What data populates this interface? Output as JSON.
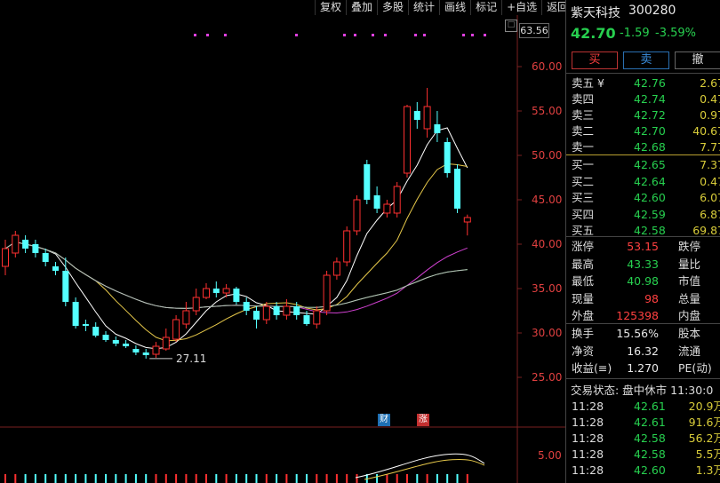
{
  "toolbar": {
    "items": [
      "复权",
      "叠加",
      "多股",
      "统计",
      "画线",
      "标记",
      "+自选",
      "返回"
    ]
  },
  "stock": {
    "name": "紫天科技",
    "code": "300280",
    "price": "42.70",
    "change": "-1.59",
    "pct": "-3.59%"
  },
  "trade_buttons": {
    "buy": "买",
    "sell": "卖",
    "cancel": "撤"
  },
  "sell_orders": [
    {
      "label": "卖五 ¥",
      "price": "42.76",
      "vol": "2.67"
    },
    {
      "label": "卖四",
      "price": "42.74",
      "vol": "0.47"
    },
    {
      "label": "卖三",
      "price": "42.72",
      "vol": "0.97"
    },
    {
      "label": "卖二",
      "price": "42.70",
      "vol": "40.67"
    },
    {
      "label": "卖一",
      "price": "42.68",
      "vol": "7.77"
    }
  ],
  "buy_orders": [
    {
      "label": "买一",
      "price": "42.65",
      "vol": "7.37"
    },
    {
      "label": "买二",
      "price": "42.64",
      "vol": "0.47"
    },
    {
      "label": "买三",
      "price": "42.60",
      "vol": "6.07"
    },
    {
      "label": "买四",
      "price": "42.59",
      "vol": "6.87"
    },
    {
      "label": "买五",
      "price": "42.58",
      "vol": "69.87"
    }
  ],
  "stats1": [
    {
      "l1": "涨停",
      "v1": "53.15",
      "c1": "red",
      "l2": "跌停"
    },
    {
      "l1": "最高",
      "v1": "43.33",
      "c1": "grn",
      "l2": "量比"
    },
    {
      "l1": "最低",
      "v1": "40.98",
      "c1": "grn",
      "l2": "市值"
    },
    {
      "l1": "现量",
      "v1": "98",
      "c1": "red",
      "l2": "总量"
    },
    {
      "l1": "外盘",
      "v1": "125398",
      "c1": "red",
      "l2": "内盘"
    }
  ],
  "stats2": [
    {
      "l1": "换手",
      "v1": "15.56%",
      "l2": "股本"
    },
    {
      "l1": "净资",
      "v1": "16.32",
      "l2": "流通"
    },
    {
      "l1": "收益(≡)",
      "v1": "1.270",
      "l2": "PE(动)"
    }
  ],
  "trade_status": "交易状态: 盘中休市 11:30:0",
  "ticks": [
    {
      "time": "11:28",
      "price": "42.61",
      "vol": "20.9万"
    },
    {
      "time": "11:28",
      "price": "42.61",
      "vol": "91.6万"
    },
    {
      "time": "11:28",
      "price": "42.58",
      "vol": "56.2万"
    },
    {
      "time": "11:28",
      "price": "42.58",
      "vol": "5.5万"
    },
    {
      "time": "11:28",
      "price": "42.60",
      "vol": "1.3万"
    }
  ],
  "chart_data": {
    "type": "candlestick",
    "y_ticks": [
      "60.00",
      "55.00",
      "50.00",
      "45.00",
      "40.00",
      "35.00",
      "30.00",
      "25.00"
    ],
    "volume_tick": "5.00",
    "max_label": "63.56",
    "min_label": "27.11",
    "event_markers": [
      "财",
      "涨"
    ],
    "candles": [
      {
        "o": 37.5,
        "c": 39.5,
        "h": 40.5,
        "l": 36.5
      },
      {
        "o": 39.0,
        "c": 41.0,
        "h": 41.5,
        "l": 38.5
      },
      {
        "o": 40.5,
        "c": 39.5,
        "h": 41.0,
        "l": 39.0
      },
      {
        "o": 40.0,
        "c": 39.0,
        "h": 40.5,
        "l": 38.5
      },
      {
        "o": 39.0,
        "c": 38.0,
        "h": 39.5,
        "l": 37.5
      },
      {
        "o": 37.5,
        "c": 37.0,
        "h": 38.0,
        "l": 36.5
      },
      {
        "o": 37.0,
        "c": 33.5,
        "h": 38.5,
        "l": 33.0
      },
      {
        "o": 33.5,
        "c": 30.8,
        "h": 34.0,
        "l": 30.5
      },
      {
        "o": 31.0,
        "c": 30.8,
        "h": 31.5,
        "l": 30.2
      },
      {
        "o": 30.7,
        "c": 29.7,
        "h": 31.2,
        "l": 29.5
      },
      {
        "o": 29.8,
        "c": 29.2,
        "h": 30.2,
        "l": 29.0
      },
      {
        "o": 29.2,
        "c": 28.8,
        "h": 29.6,
        "l": 28.5
      },
      {
        "o": 28.8,
        "c": 28.5,
        "h": 29.2,
        "l": 28.3
      },
      {
        "o": 28.2,
        "c": 27.8,
        "h": 28.6,
        "l": 27.5
      },
      {
        "o": 27.8,
        "c": 27.5,
        "h": 28.2,
        "l": 27.11
      },
      {
        "o": 27.6,
        "c": 28.5,
        "h": 29.0,
        "l": 27.2
      },
      {
        "o": 28.2,
        "c": 29.5,
        "h": 30.5,
        "l": 28.0
      },
      {
        "o": 29.3,
        "c": 31.5,
        "h": 32.0,
        "l": 29.0
      },
      {
        "o": 31.0,
        "c": 32.5,
        "h": 33.5,
        "l": 30.5
      },
      {
        "o": 32.5,
        "c": 34.0,
        "h": 35.0,
        "l": 32.0
      },
      {
        "o": 34.0,
        "c": 35.0,
        "h": 35.6,
        "l": 33.8
      },
      {
        "o": 35.0,
        "c": 34.5,
        "h": 35.8,
        "l": 34.0
      },
      {
        "o": 34.5,
        "c": 35.0,
        "h": 35.5,
        "l": 34.0
      },
      {
        "o": 35.0,
        "c": 33.5,
        "h": 35.2,
        "l": 33.2
      },
      {
        "o": 33.5,
        "c": 32.5,
        "h": 34.0,
        "l": 32.0
      },
      {
        "o": 32.5,
        "c": 31.5,
        "h": 33.0,
        "l": 30.5
      },
      {
        "o": 31.5,
        "c": 33.0,
        "h": 33.5,
        "l": 31.0
      },
      {
        "o": 33.0,
        "c": 32.0,
        "h": 33.5,
        "l": 31.5
      },
      {
        "o": 32.0,
        "c": 33.0,
        "h": 33.8,
        "l": 31.5
      },
      {
        "o": 33.0,
        "c": 32.0,
        "h": 33.5,
        "l": 31.5
      },
      {
        "o": 32.0,
        "c": 31.0,
        "h": 32.5,
        "l": 30.8
      },
      {
        "o": 31.0,
        "c": 32.5,
        "h": 33.0,
        "l": 30.5
      },
      {
        "o": 32.5,
        "c": 36.5,
        "h": 37.0,
        "l": 32.0
      },
      {
        "o": 36.5,
        "c": 38.0,
        "h": 38.5,
        "l": 36.0
      },
      {
        "o": 38.0,
        "c": 41.5,
        "h": 42.0,
        "l": 37.5
      },
      {
        "o": 41.5,
        "c": 45.0,
        "h": 45.5,
        "l": 41.0
      },
      {
        "o": 49.0,
        "c": 45.0,
        "h": 49.5,
        "l": 44.5
      },
      {
        "o": 45.5,
        "c": 44.0,
        "h": 46.5,
        "l": 43.5
      },
      {
        "o": 43.5,
        "c": 44.5,
        "h": 45.0,
        "l": 43.0
      },
      {
        "o": 43.5,
        "c": 46.5,
        "h": 47.0,
        "l": 43.0
      },
      {
        "o": 48.0,
        "c": 55.5,
        "h": 55.7,
        "l": 47.5
      },
      {
        "o": 55.0,
        "c": 54.0,
        "h": 56.0,
        "l": 53.0
      },
      {
        "o": 53.0,
        "c": 55.5,
        "h": 57.6,
        "l": 52.0
      },
      {
        "o": 53.5,
        "c": 52.5,
        "h": 55.0,
        "l": 51.5
      },
      {
        "o": 51.5,
        "c": 48.0,
        "h": 52.0,
        "l": 47.5
      },
      {
        "o": 48.5,
        "c": 44.0,
        "h": 49.0,
        "l": 43.5
      },
      {
        "o": 42.5,
        "c": 43.0,
        "h": 43.33,
        "l": 40.98
      }
    ]
  }
}
